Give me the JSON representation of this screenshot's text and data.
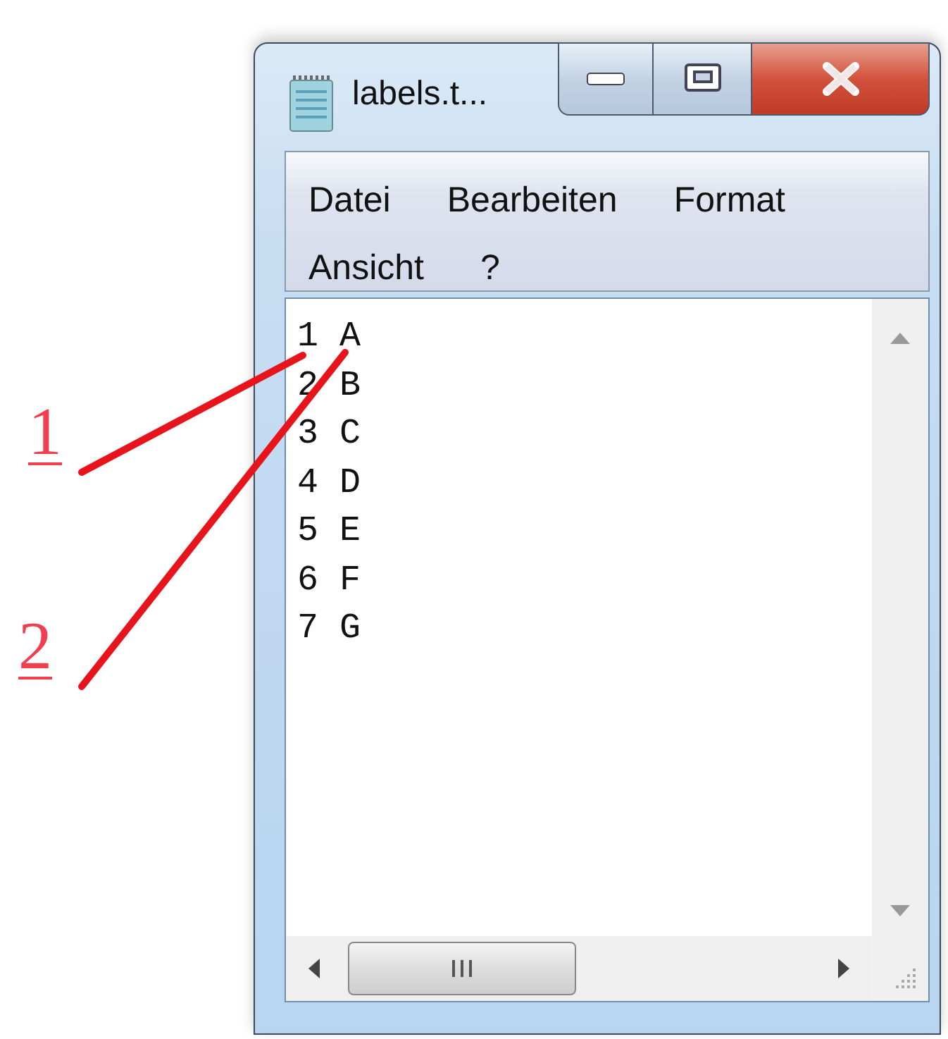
{
  "window": {
    "title": "labels.t..."
  },
  "menu": [
    "Datei",
    "Bearbeiten",
    "Format",
    "Ansicht",
    "?"
  ],
  "editor": {
    "lines": [
      "1 A",
      "2 B",
      "3 C",
      "4 D",
      "5 E",
      "6 F",
      "7 G"
    ]
  },
  "annotations": [
    {
      "label": "1"
    },
    {
      "label": "2"
    }
  ]
}
